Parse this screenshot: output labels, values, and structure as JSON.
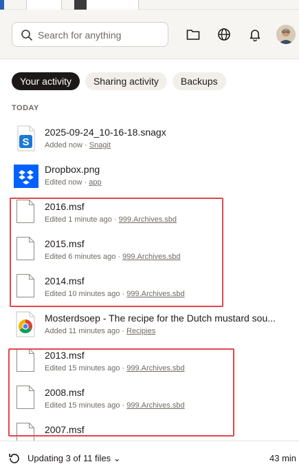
{
  "search": {
    "placeholder": "Search for anything"
  },
  "header_icons": [
    "folder-icon",
    "globe-icon",
    "bell-icon",
    "avatar"
  ],
  "tabs": [
    {
      "label": "Your activity",
      "active": true
    },
    {
      "label": "Sharing activity",
      "active": false
    },
    {
      "label": "Backups",
      "active": false
    }
  ],
  "section_label": "TODAY",
  "items": [
    {
      "name": "2025-09-24_10-16-18.snagx",
      "status": "Added now",
      "sep": " · ",
      "location": "Snagit",
      "icon": "snagit-icon"
    },
    {
      "name": "Dropbox.png",
      "status": "Edited now",
      "sep": " · ",
      "location": "app",
      "icon": "dropbox-icon"
    },
    {
      "name": "2016.msf",
      "status": "Edited 1 minute ago",
      "sep": " · ",
      "location": "999.Archives.sbd",
      "icon": "file-icon"
    },
    {
      "name": "2015.msf",
      "status": "Edited 6 minutes ago",
      "sep": " · ",
      "location": "999.Archives.sbd",
      "icon": "file-icon"
    },
    {
      "name": "2014.msf",
      "status": "Edited 10 minutes ago",
      "sep": " · ",
      "location": "999.Archives.sbd",
      "icon": "file-icon"
    },
    {
      "name": "Mosterdsoep - The recipe for the Dutch mustard sou...",
      "status": "Added 11 minutes ago",
      "sep": " · ",
      "location": "Recipies",
      "icon": "chrome-icon"
    },
    {
      "name": "2013.msf",
      "status": "Edited 15 minutes ago",
      "sep": " · ",
      "location": "999.Archives.sbd",
      "icon": "file-icon"
    },
    {
      "name": "2008.msf",
      "status": "Edited 15 minutes ago",
      "sep": " · ",
      "location": "999.Archives.sbd",
      "icon": "file-icon"
    },
    {
      "name": "2007.msf",
      "status": "",
      "sep": "",
      "location": "",
      "icon": "file-icon"
    }
  ],
  "bottom": {
    "status": "Updating 3 of 11 files",
    "right": "43 min"
  },
  "colors": {
    "accent_dark": "#1e1919",
    "highlight": "#e0464d",
    "dropbox_blue": "#0061fe"
  }
}
